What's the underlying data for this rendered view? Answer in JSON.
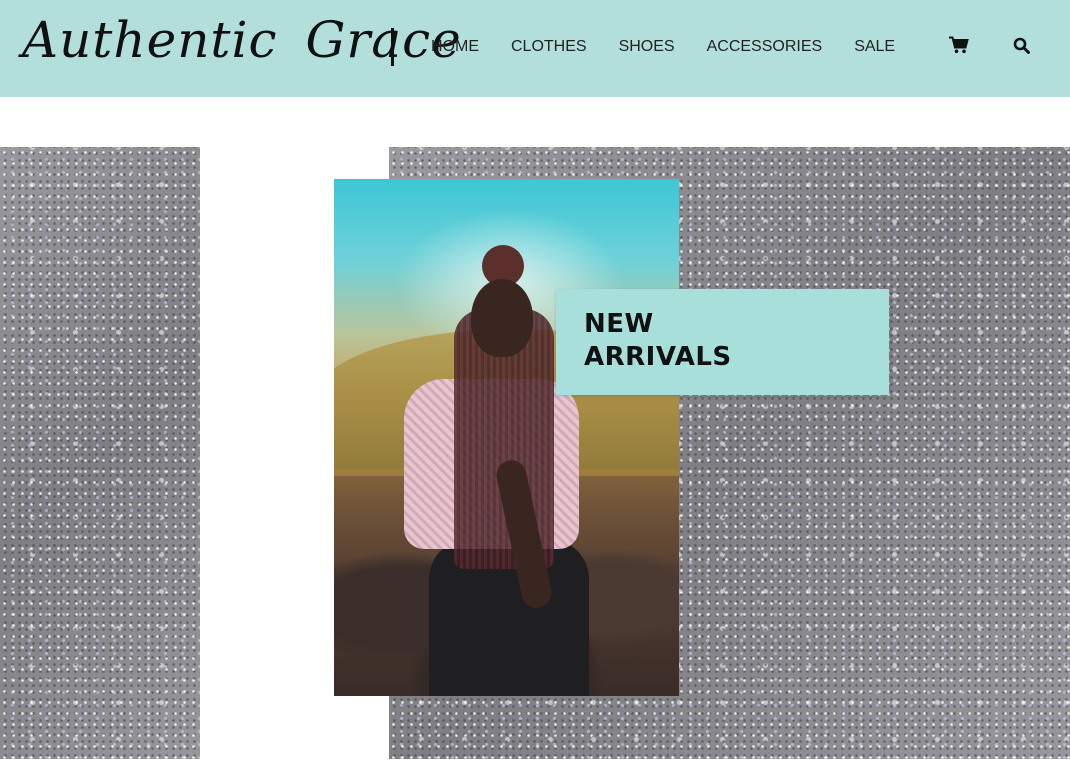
{
  "header": {
    "logo": {
      "word1": "Authentic",
      "word2": "Grace"
    },
    "nav": [
      {
        "label": "HOME"
      },
      {
        "label": "CLOTHES"
      },
      {
        "label": "SHOES"
      },
      {
        "label": "ACCESSORIES"
      },
      {
        "label": "SALE"
      }
    ],
    "icons": {
      "cart": "cart-icon",
      "search": "search-icon"
    }
  },
  "hero": {
    "badge": {
      "line1": "NEW",
      "line2": "ARRIVALS"
    },
    "image": "woman-with-braids-photo"
  },
  "colors": {
    "header_bg": "#b2dfdc",
    "badge_bg": "#a9dfdb",
    "glitter": "#8c8c8f",
    "text": "#111111"
  }
}
